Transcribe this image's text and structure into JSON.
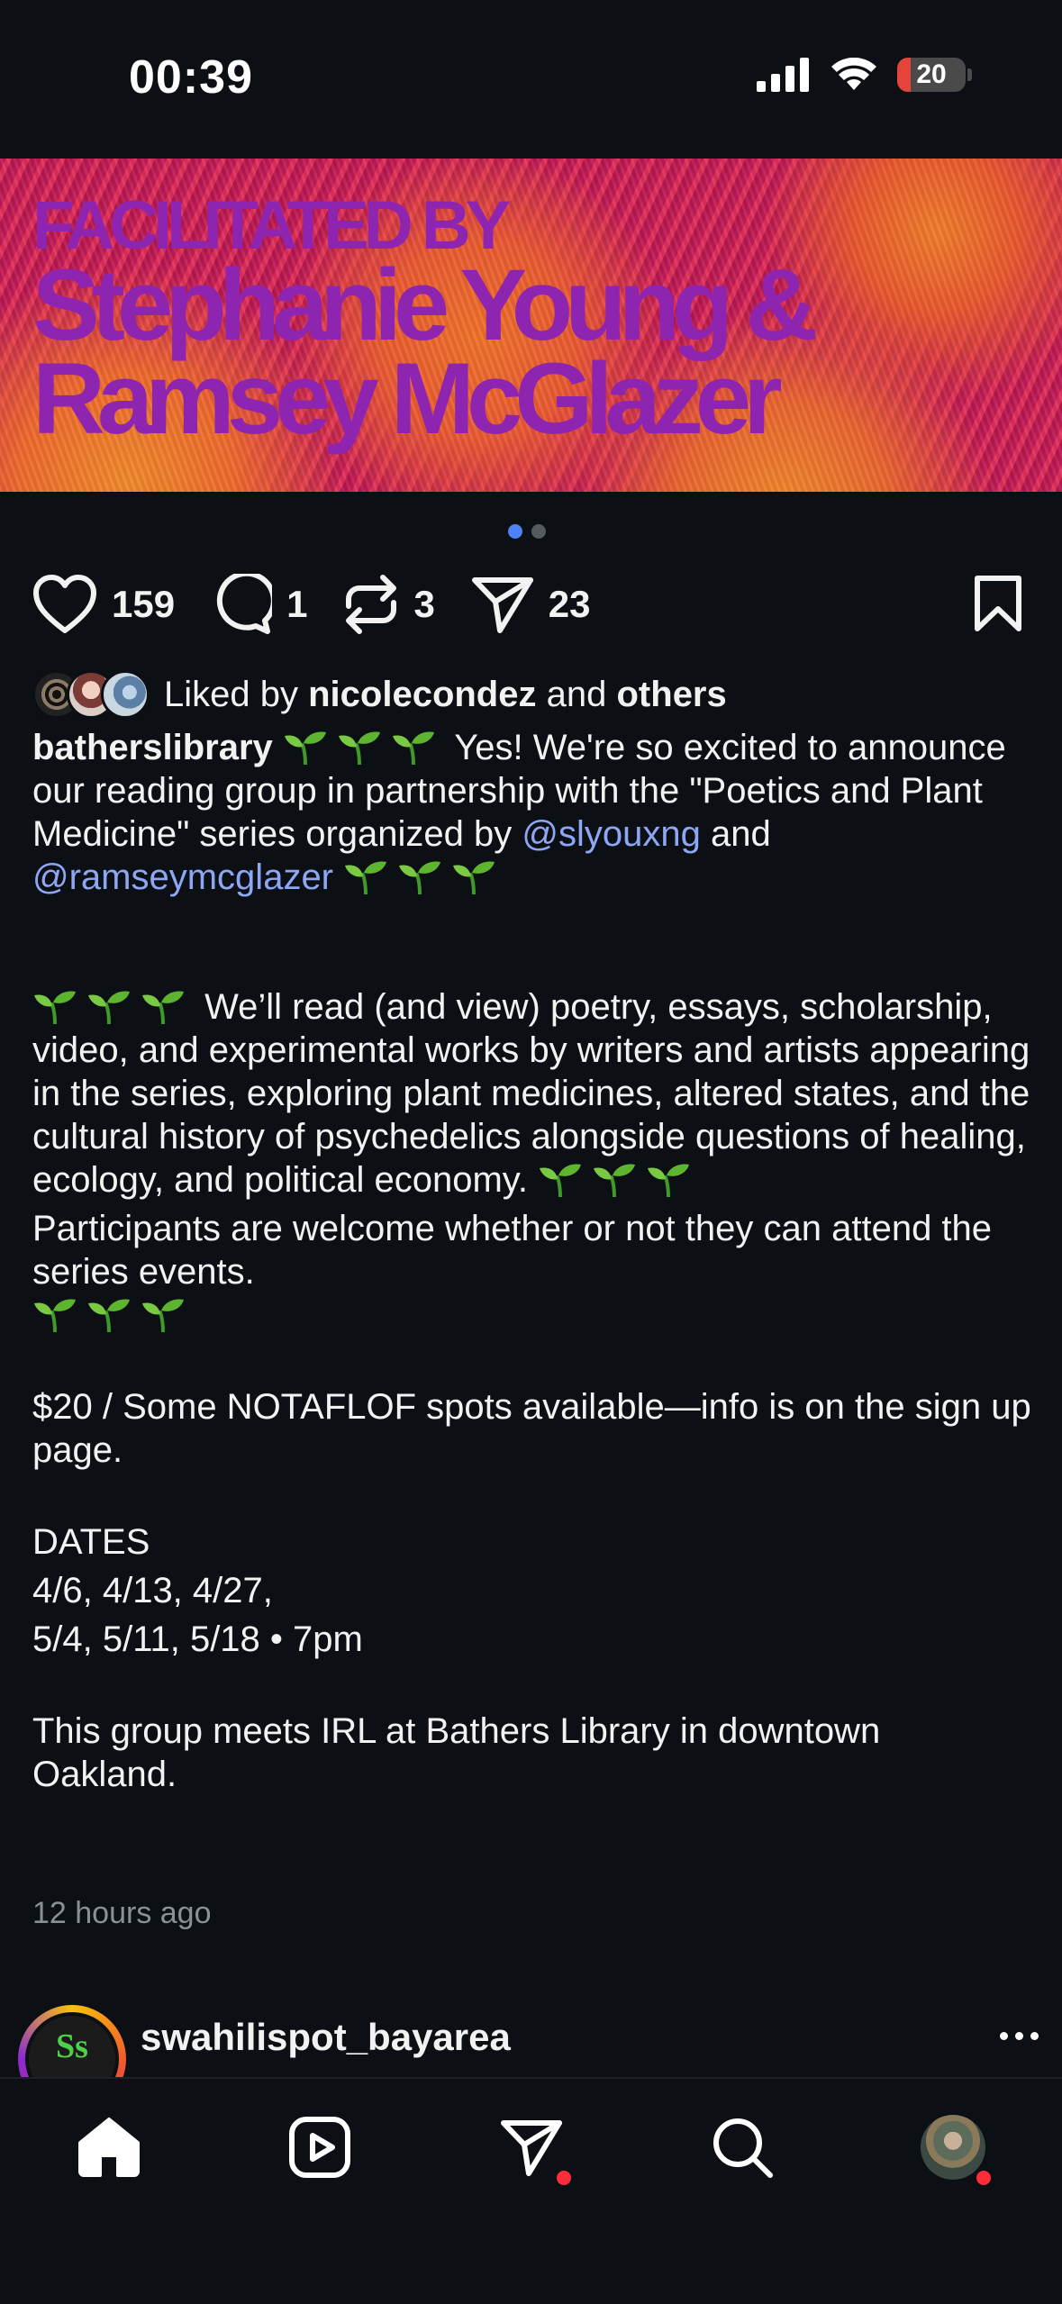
{
  "status_bar": {
    "time": "00:39",
    "battery_percent": "20",
    "battery_level": 0.2
  },
  "banner": {
    "line1": "FACILITATED BY",
    "line2": "Stephanie Young &",
    "line3": "Ramsey McGlazer"
  },
  "carousel": {
    "count": 2,
    "active_index": 0
  },
  "actions": {
    "likes": "159",
    "comments": "1",
    "reposts": "3",
    "shares": "23"
  },
  "liked_by": {
    "prefix": "Liked by",
    "user": "nicolecondez",
    "and": "and",
    "others": "others"
  },
  "caption": {
    "username": "batherslibrary",
    "p1_text": "Yes! We're so excited to announce our reading group in partnership with the \"Poetics and Plant Medicine\" series organized by",
    "mention1": "@slyouxng",
    "and": "and",
    "mention2": "@ramseymcglazer",
    "p2_text": "We’ll read (and view) poetry, essays, scholarship, video, and experimental works by writers and artists appearing in the series, exploring plant medicines, altered states, and the cultural history of psychedelics alongside questions of healing, ecology, and political economy.",
    "p3_text": "Participants are welcome whether or not they can attend the series events.",
    "price": "$20 / Some NOTAFLOF spots available—info is on the sign up page.",
    "dates_heading": "DATES",
    "dates_line1": "4/6, 4/13, 4/27,",
    "dates_line2": "5/4, 5/11, 5/18 • 7pm",
    "location": "This group meets IRL at Bathers Library in downtown Oakland."
  },
  "timestamp": "12 hours ago",
  "next_post": {
    "username": "swahilispot_bayarea",
    "avatar_text": "Ss"
  },
  "icons": {
    "like": "heart-icon",
    "comment": "comment-icon",
    "repost": "repost-icon",
    "share": "send-icon",
    "save": "bookmark-icon",
    "sprout": "seedling-emoji",
    "nav": [
      "home-icon",
      "reels-icon",
      "direct-messages-icon",
      "search-icon",
      "profile-avatar"
    ]
  },
  "colors": {
    "mention": "#8ea7f5",
    "active_dot": "#4c83f5",
    "notification": "#ff2d3a",
    "banner_text": "#8e25b0"
  }
}
